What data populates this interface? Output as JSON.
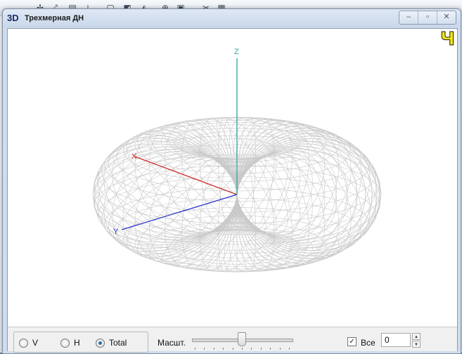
{
  "window": {
    "app_icon_text": "3D",
    "title": "Трехмерная ДН",
    "corner_mark": "Ч",
    "buttons": [
      "minimize",
      "maximize",
      "close"
    ]
  },
  "axes": {
    "x_label": "X",
    "y_label": "Y",
    "z_label": "Z",
    "colors": {
      "x": "#cc2b2b",
      "y": "#2b35c8",
      "z": "#2aa7a0",
      "mesh": "#c9c9c9"
    }
  },
  "controls": {
    "modes": [
      {
        "label": "V",
        "selected": false
      },
      {
        "label": "H",
        "selected": false
      },
      {
        "label": "Total",
        "selected": true
      }
    ],
    "scale_label": "Масшт.",
    "scale_slider": {
      "value": 0.5,
      "ticks": 11
    },
    "all_checkbox": {
      "label": "Все",
      "checked": true,
      "mark": "✓"
    },
    "number_value": "0",
    "spin_up": "▲",
    "spin_down": "▼"
  },
  "background": {
    "tool_glyphs": [
      "✢",
      "⤢",
      "▤",
      "⟂",
      "▢",
      "◩",
      "◭",
      "⊕",
      "▣",
      "✂",
      "▦"
    ]
  }
}
